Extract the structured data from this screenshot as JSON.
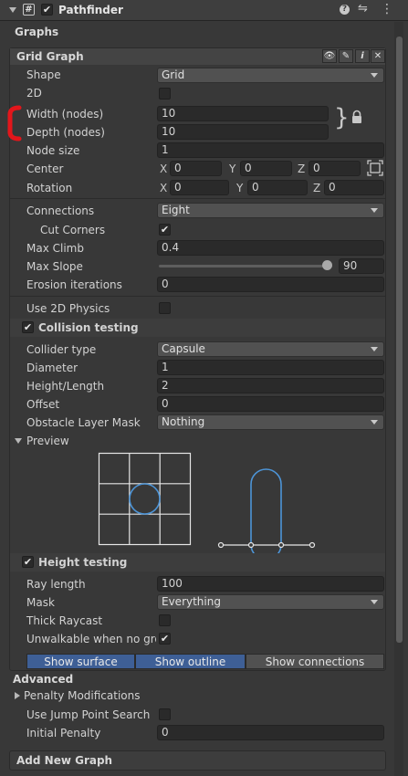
{
  "header": {
    "title": "Pathfinder",
    "component_icon": "#"
  },
  "sections": {
    "graphs": "Graphs",
    "advanced": "Advanced",
    "add_new_graph": "Add New Graph"
  },
  "grid_graph": {
    "title": "Grid Graph",
    "shape": {
      "label": "Shape",
      "value": "Grid"
    },
    "two_d": {
      "label": "2D"
    },
    "width": {
      "label": "Width (nodes)",
      "value": "10"
    },
    "depth": {
      "label": "Depth (nodes)",
      "value": "10"
    },
    "node_size": {
      "label": "Node size",
      "value": "1"
    },
    "center": {
      "label": "Center",
      "x": "0",
      "y": "0",
      "z": "0"
    },
    "rotation": {
      "label": "Rotation",
      "x": "0",
      "y": "0",
      "z": "0"
    },
    "axes": {
      "x": "X",
      "y": "Y",
      "z": "Z"
    }
  },
  "connections": {
    "connections": {
      "label": "Connections",
      "value": "Eight"
    },
    "cut_corners": {
      "label": "Cut Corners"
    },
    "max_climb": {
      "label": "Max Climb",
      "value": "0.4"
    },
    "max_slope": {
      "label": "Max Slope",
      "value": "90",
      "fraction": 1.0
    },
    "erosion": {
      "label": "Erosion iterations",
      "value": "0"
    }
  },
  "collision": {
    "use_2d_physics": {
      "label": "Use 2D Physics"
    },
    "collision_testing": {
      "label": "Collision testing"
    },
    "collider_type": {
      "label": "Collider type",
      "value": "Capsule"
    },
    "diameter": {
      "label": "Diameter",
      "value": "1"
    },
    "height_length": {
      "label": "Height/Length",
      "value": "2"
    },
    "offset": {
      "label": "Offset",
      "value": "0"
    },
    "obstacle_mask": {
      "label": "Obstacle Layer Mask",
      "value": "Nothing"
    },
    "preview": {
      "label": "Preview"
    }
  },
  "height": {
    "height_testing": {
      "label": "Height testing"
    },
    "ray_length": {
      "label": "Ray length",
      "value": "100"
    },
    "mask": {
      "label": "Mask",
      "value": "Everything"
    },
    "thick_raycast": {
      "label": "Thick Raycast"
    },
    "unwalkable": {
      "label": "Unwalkable when no ground"
    }
  },
  "toggles": {
    "show_surface": "Show surface",
    "show_outline": "Show outline",
    "show_connections": "Show connections"
  },
  "advanced": {
    "penalty": {
      "label": "Penalty Modifications"
    },
    "jump_point": {
      "label": "Use Jump Point Search"
    },
    "initial_penalty": {
      "label": "Initial Penalty",
      "value": "0"
    }
  },
  "colors": {
    "accent_blue": "#3e5f96",
    "preview_blue": "#4d95d8",
    "red_mark": "#e3161b"
  }
}
